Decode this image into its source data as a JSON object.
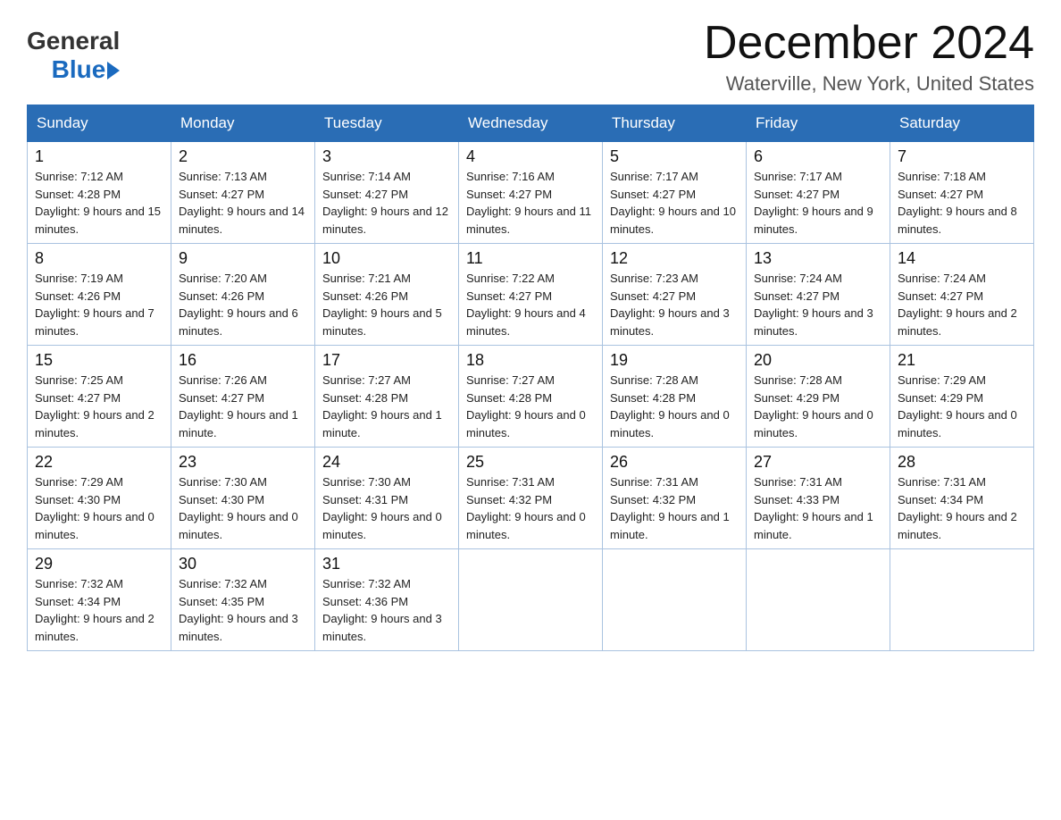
{
  "header": {
    "logo_general": "General",
    "logo_blue": "Blue",
    "month_title": "December 2024",
    "location": "Waterville, New York, United States"
  },
  "days_of_week": [
    "Sunday",
    "Monday",
    "Tuesday",
    "Wednesday",
    "Thursday",
    "Friday",
    "Saturday"
  ],
  "weeks": [
    [
      {
        "num": "1",
        "sunrise": "7:12 AM",
        "sunset": "4:28 PM",
        "daylight": "9 hours and 15 minutes."
      },
      {
        "num": "2",
        "sunrise": "7:13 AM",
        "sunset": "4:27 PM",
        "daylight": "9 hours and 14 minutes."
      },
      {
        "num": "3",
        "sunrise": "7:14 AM",
        "sunset": "4:27 PM",
        "daylight": "9 hours and 12 minutes."
      },
      {
        "num": "4",
        "sunrise": "7:16 AM",
        "sunset": "4:27 PM",
        "daylight": "9 hours and 11 minutes."
      },
      {
        "num": "5",
        "sunrise": "7:17 AM",
        "sunset": "4:27 PM",
        "daylight": "9 hours and 10 minutes."
      },
      {
        "num": "6",
        "sunrise": "7:17 AM",
        "sunset": "4:27 PM",
        "daylight": "9 hours and 9 minutes."
      },
      {
        "num": "7",
        "sunrise": "7:18 AM",
        "sunset": "4:27 PM",
        "daylight": "9 hours and 8 minutes."
      }
    ],
    [
      {
        "num": "8",
        "sunrise": "7:19 AM",
        "sunset": "4:26 PM",
        "daylight": "9 hours and 7 minutes."
      },
      {
        "num": "9",
        "sunrise": "7:20 AM",
        "sunset": "4:26 PM",
        "daylight": "9 hours and 6 minutes."
      },
      {
        "num": "10",
        "sunrise": "7:21 AM",
        "sunset": "4:26 PM",
        "daylight": "9 hours and 5 minutes."
      },
      {
        "num": "11",
        "sunrise": "7:22 AM",
        "sunset": "4:27 PM",
        "daylight": "9 hours and 4 minutes."
      },
      {
        "num": "12",
        "sunrise": "7:23 AM",
        "sunset": "4:27 PM",
        "daylight": "9 hours and 3 minutes."
      },
      {
        "num": "13",
        "sunrise": "7:24 AM",
        "sunset": "4:27 PM",
        "daylight": "9 hours and 3 minutes."
      },
      {
        "num": "14",
        "sunrise": "7:24 AM",
        "sunset": "4:27 PM",
        "daylight": "9 hours and 2 minutes."
      }
    ],
    [
      {
        "num": "15",
        "sunrise": "7:25 AM",
        "sunset": "4:27 PM",
        "daylight": "9 hours and 2 minutes."
      },
      {
        "num": "16",
        "sunrise": "7:26 AM",
        "sunset": "4:27 PM",
        "daylight": "9 hours and 1 minute."
      },
      {
        "num": "17",
        "sunrise": "7:27 AM",
        "sunset": "4:28 PM",
        "daylight": "9 hours and 1 minute."
      },
      {
        "num": "18",
        "sunrise": "7:27 AM",
        "sunset": "4:28 PM",
        "daylight": "9 hours and 0 minutes."
      },
      {
        "num": "19",
        "sunrise": "7:28 AM",
        "sunset": "4:28 PM",
        "daylight": "9 hours and 0 minutes."
      },
      {
        "num": "20",
        "sunrise": "7:28 AM",
        "sunset": "4:29 PM",
        "daylight": "9 hours and 0 minutes."
      },
      {
        "num": "21",
        "sunrise": "7:29 AM",
        "sunset": "4:29 PM",
        "daylight": "9 hours and 0 minutes."
      }
    ],
    [
      {
        "num": "22",
        "sunrise": "7:29 AM",
        "sunset": "4:30 PM",
        "daylight": "9 hours and 0 minutes."
      },
      {
        "num": "23",
        "sunrise": "7:30 AM",
        "sunset": "4:30 PM",
        "daylight": "9 hours and 0 minutes."
      },
      {
        "num": "24",
        "sunrise": "7:30 AM",
        "sunset": "4:31 PM",
        "daylight": "9 hours and 0 minutes."
      },
      {
        "num": "25",
        "sunrise": "7:31 AM",
        "sunset": "4:32 PM",
        "daylight": "9 hours and 0 minutes."
      },
      {
        "num": "26",
        "sunrise": "7:31 AM",
        "sunset": "4:32 PM",
        "daylight": "9 hours and 1 minute."
      },
      {
        "num": "27",
        "sunrise": "7:31 AM",
        "sunset": "4:33 PM",
        "daylight": "9 hours and 1 minute."
      },
      {
        "num": "28",
        "sunrise": "7:31 AM",
        "sunset": "4:34 PM",
        "daylight": "9 hours and 2 minutes."
      }
    ],
    [
      {
        "num": "29",
        "sunrise": "7:32 AM",
        "sunset": "4:34 PM",
        "daylight": "9 hours and 2 minutes."
      },
      {
        "num": "30",
        "sunrise": "7:32 AM",
        "sunset": "4:35 PM",
        "daylight": "9 hours and 3 minutes."
      },
      {
        "num": "31",
        "sunrise": "7:32 AM",
        "sunset": "4:36 PM",
        "daylight": "9 hours and 3 minutes."
      },
      null,
      null,
      null,
      null
    ]
  ]
}
